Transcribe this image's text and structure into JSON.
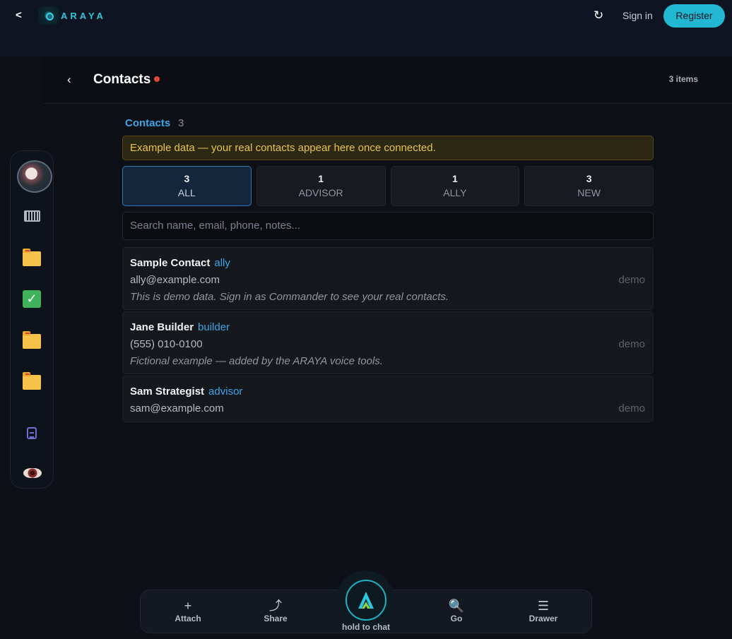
{
  "topbar": {
    "back_label": "<",
    "brand": "ARAYA",
    "refresh_icon": "↻",
    "sign_in": "Sign in",
    "register": "Register"
  },
  "header": {
    "back_icon": "‹",
    "title": "Contacts",
    "count": "3 items"
  },
  "section": {
    "title": "Contacts",
    "count": "3"
  },
  "banner": "Example data — your real contacts appear here once connected.",
  "filters": [
    {
      "count": "3",
      "label": "ALL",
      "active": true
    },
    {
      "count": "1",
      "label": "ADVISOR",
      "active": false
    },
    {
      "count": "1",
      "label": "ALLY",
      "active": false
    },
    {
      "count": "3",
      "label": "NEW",
      "active": false
    }
  ],
  "search": {
    "placeholder": "Search name, email, phone, notes..."
  },
  "contacts": [
    {
      "name": "Sample Contact",
      "tag": "ally",
      "detail": "ally@example.com",
      "note": "This is demo data. Sign in as Commander to see your real contacts.",
      "source": "demo"
    },
    {
      "name": "Jane Builder",
      "tag": "builder",
      "detail": "(555) 010-0100",
      "note": "Fictional example — added by the ARAYA voice tools.",
      "source": "demo"
    },
    {
      "name": "Sam Strategist",
      "tag": "advisor",
      "detail": "sam@example.com",
      "note": "",
      "source": "demo"
    }
  ],
  "rail": {
    "icons": [
      "avatar",
      "keyboard-icon",
      "folder-icon",
      "checkbox-icon",
      "folder-icon",
      "folder-icon",
      "clipboard-icon",
      "eye-icon"
    ]
  },
  "dock": {
    "attach": {
      "icon": "+",
      "label": "Attach"
    },
    "share": {
      "icon": "⤴",
      "label": "Share"
    },
    "chat": {
      "label": "hold to chat"
    },
    "go": {
      "icon": "🔍",
      "label": "Go"
    },
    "drawer": {
      "icon": "☰",
      "label": "Drawer"
    }
  },
  "colors": {
    "accent": "#22b8d4",
    "link": "#3fa5e8",
    "banner_text": "#e8c44a",
    "status_dot": "#e0453a"
  }
}
